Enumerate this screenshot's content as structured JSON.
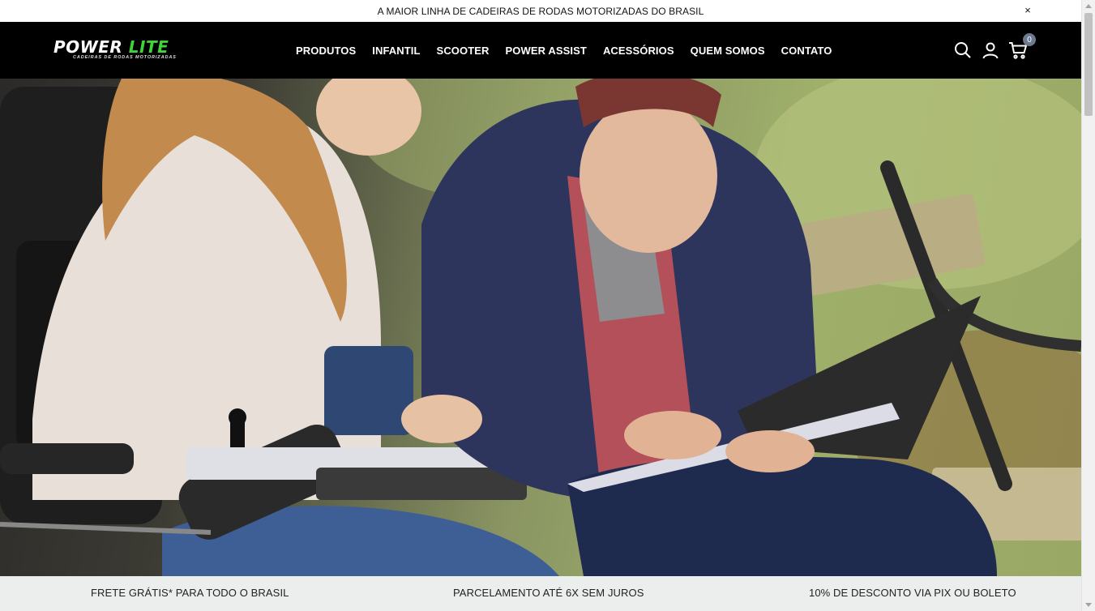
{
  "announcement": {
    "text": "A MAIOR LINHA DE CADEIRAS DE RODAS MOTORIZADAS DO BRASIL",
    "close_label": "×"
  },
  "header": {
    "logo": {
      "word1": "POWER",
      "word2": "LITE",
      "tagline": "CADEIRAS DE RODAS MOTORIZADAS"
    },
    "nav": [
      {
        "label": "PRODUTOS"
      },
      {
        "label": "INFANTIL"
      },
      {
        "label": "SCOOTER"
      },
      {
        "label": "POWER ASSIST"
      },
      {
        "label": "ACESSÓRIOS"
      },
      {
        "label": "QUEM SOMOS"
      },
      {
        "label": "CONTATO"
      }
    ],
    "icons": [
      "search-icon",
      "user-icon",
      "cart-icon"
    ],
    "cart_count": "0"
  },
  "benefits": [
    {
      "text": "FRETE GRÁTIS* PARA TODO O BRASIL"
    },
    {
      "text": "PARCELAMENTO ATÉ 6X SEM JUROS"
    },
    {
      "text": "10% DE DESCONTO VIA PIX OU BOLETO"
    }
  ],
  "colors": {
    "brand_green": "#3fd43a",
    "header_bg": "#000000",
    "badge": "#6c7a8f",
    "benefits_bg": "#eceded"
  }
}
